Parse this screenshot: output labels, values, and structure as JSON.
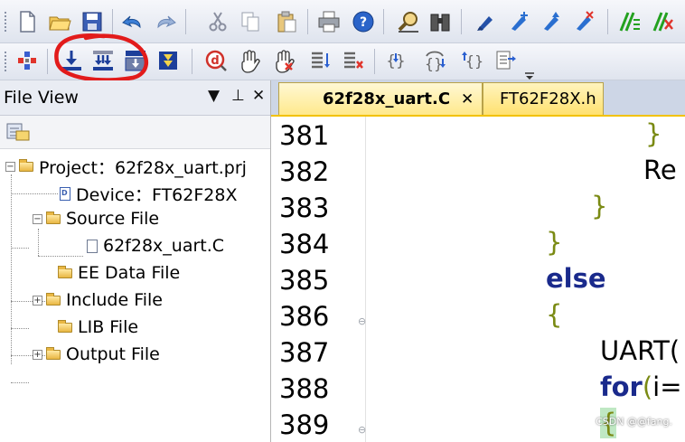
{
  "toolbar1": {
    "icons": [
      "new-file-icon",
      "open-folder-icon",
      "save-icon",
      "undo-icon",
      "redo-icon",
      "cut-icon",
      "copy-icon",
      "paste-icon",
      "print-icon",
      "help-icon",
      "find-icon",
      "binoculars-icon",
      "bookmark-icon",
      "bookmark-next-icon",
      "bookmark-prev-icon",
      "bookmark-clear-icon",
      "comment-icon",
      "uncomment-icon"
    ]
  },
  "toolbar2": {
    "icons": [
      "project-settings-icon",
      "download-icon",
      "download-all-icon",
      "download-run-icon",
      "debug-run-icon",
      "step-icon",
      "hand-icon",
      "hand-stop-icon",
      "list-icon",
      "list-clear-icon",
      "brace-step-into-icon",
      "brace-step-over-icon",
      "brace-step-out-icon",
      "run-to-cursor-icon",
      "toolbar-options-icon"
    ]
  },
  "file_view": {
    "title": "File View",
    "tree": [
      {
        "label": "Project：62f28x_uart.prj",
        "type": "folder",
        "expander": "−"
      },
      {
        "label": "Device：FT62F28X",
        "type": "device",
        "expander": ""
      },
      {
        "label": "Source File",
        "type": "folder",
        "expander": "−"
      },
      {
        "label": "62f28x_uart.C",
        "type": "doc",
        "expander": ""
      },
      {
        "label": "EE Data File",
        "type": "folder",
        "expander": ""
      },
      {
        "label": "Include File",
        "type": "folder",
        "expander": "+"
      },
      {
        "label": "LIB File",
        "type": "folder",
        "expander": ""
      },
      {
        "label": "Output File",
        "type": "folder",
        "expander": "+"
      }
    ]
  },
  "editor": {
    "tabs": [
      {
        "label": "62f28x_uart.C",
        "close": "✕",
        "active": true
      },
      {
        "label": "FT62F28X.h",
        "active": false
      }
    ],
    "lines": [
      {
        "num": "381",
        "text": "}",
        "kind": "brace"
      },
      {
        "num": "382",
        "text": "Re",
        "kind": "plain"
      },
      {
        "num": "383",
        "text": "}",
        "kind": "brace"
      },
      {
        "num": "384",
        "text": "}",
        "kind": "brace"
      },
      {
        "num": "385",
        "text": "else",
        "kind": "kw"
      },
      {
        "num": "386",
        "text": "{",
        "kind": "brace"
      },
      {
        "num": "387",
        "text": "UART(",
        "kind": "plain"
      },
      {
        "num": "388",
        "text": "for(i=",
        "kind": "mixed"
      },
      {
        "num": "389",
        "text": "{",
        "kind": "brace"
      }
    ]
  },
  "watermark": "CSDN @@fang."
}
